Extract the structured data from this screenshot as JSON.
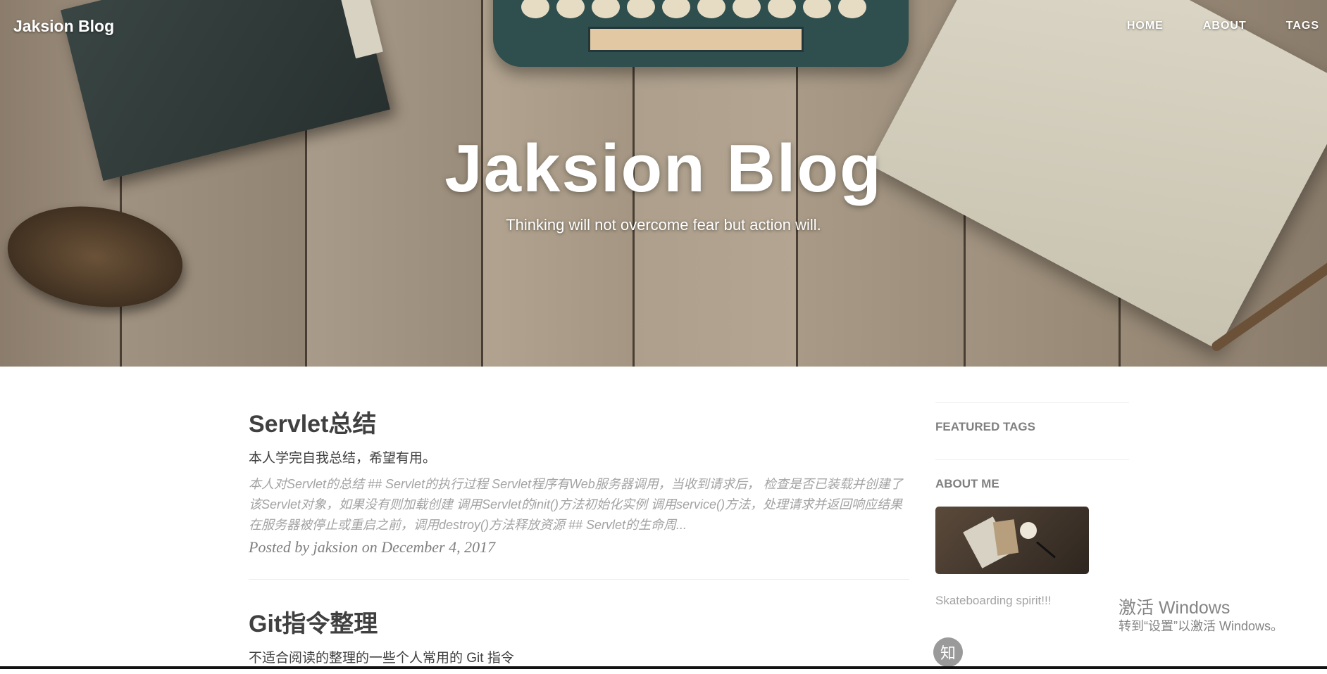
{
  "navbar": {
    "brand": "Jaksion Blog",
    "links": [
      "HOME",
      "ABOUT",
      "TAGS"
    ]
  },
  "hero": {
    "title": "Jaksion Blog",
    "subtitle": "Thinking will not overcome fear but action will."
  },
  "posts": [
    {
      "title": "Servlet总结",
      "subtitle": "本人学完自我总结，希望有用。",
      "excerpt": "本人对Servlet的总结 ## Servlet的执行过程 Servlet程序有Web服务器调用，当收到请求后， 检查是否已装载并创建了该Servlet对象，如果没有则加载创建 调用Servlet的init()方法初始化实例 调用service()方法，处理请求并返回响应结果 在服务器被停止或重启之前，调用destroy()方法释放资源 ## Servlet的生命周...",
      "meta": "Posted by jaksion on December 4, 2017"
    },
    {
      "title": "Git指令整理",
      "subtitle": "不适合阅读的整理的一些个人常用的 Git 指令"
    }
  ],
  "sidebar": {
    "featured_tags_heading": "FEATURED TAGS",
    "about_heading": "ABOUT ME",
    "about_text": "Skateboarding spirit!!!",
    "social_icon_glyph": "知"
  },
  "watermark": {
    "title": "激活 Windows",
    "subtitle": "转到“设置”以激活 Windows。"
  },
  "colors": {
    "heading": "#404040",
    "muted": "#a3a3a3",
    "meta": "#808080"
  }
}
